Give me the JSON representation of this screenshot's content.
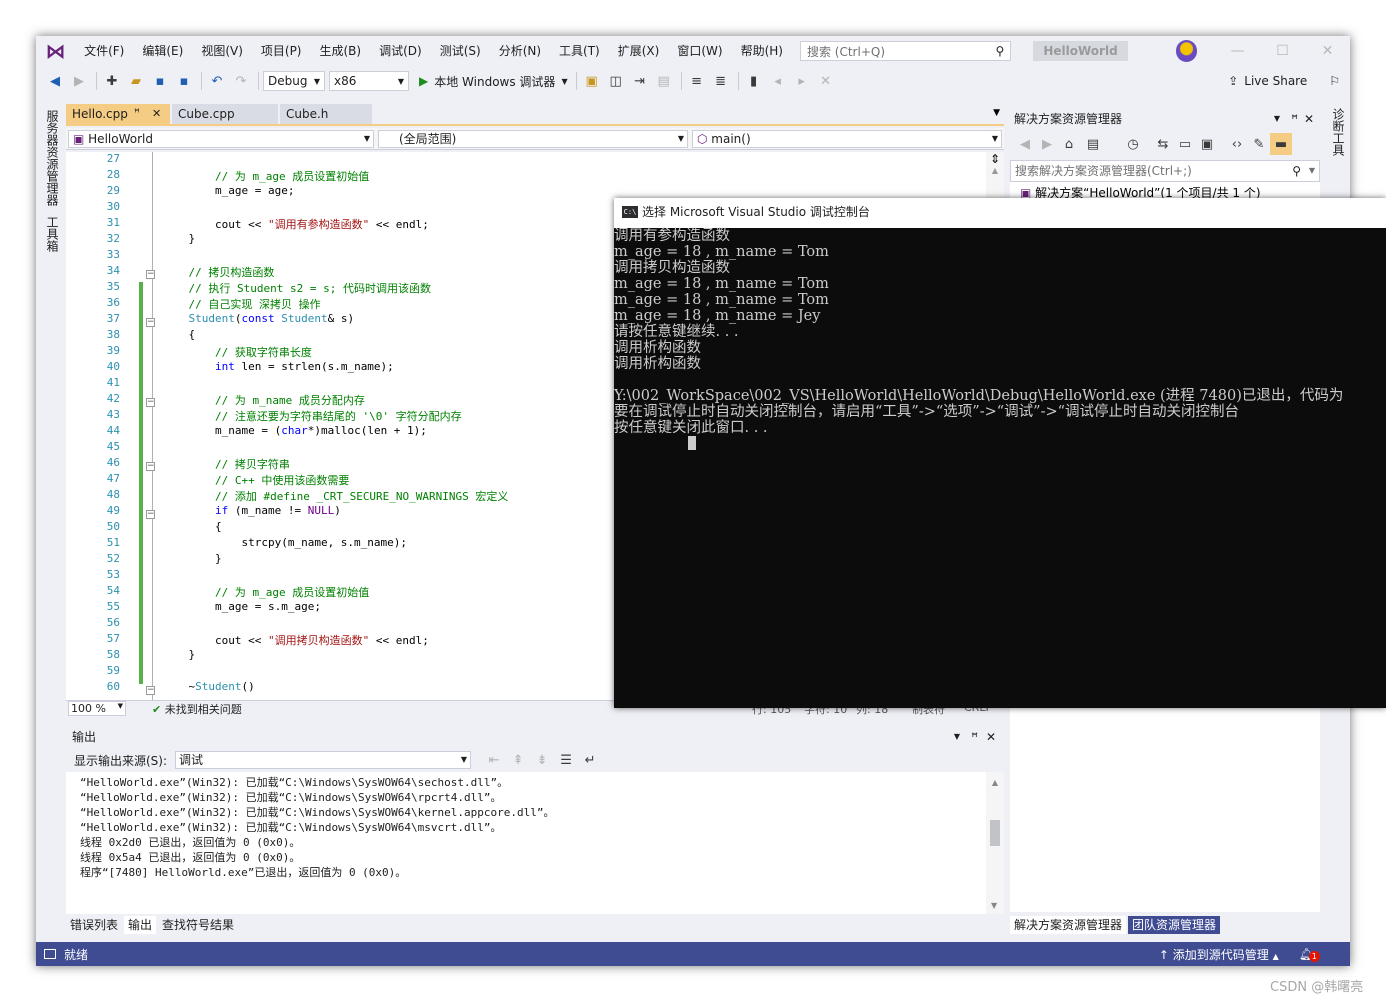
{
  "menu": {
    "items": [
      "文件(F)",
      "编辑(E)",
      "视图(V)",
      "项目(P)",
      "生成(B)",
      "调试(D)",
      "测试(S)",
      "分析(N)",
      "工具(T)",
      "扩展(X)",
      "窗口(W)",
      "帮助(H)"
    ],
    "search_placeholder": "搜索 (Ctrl+Q)",
    "solution_name": "HelloWorld"
  },
  "toolbar": {
    "config": "Debug",
    "platform": "x86",
    "run_label": "本地 Windows 调试器",
    "live_share": "Live Share"
  },
  "left_strip": {
    "server_explorer": "服务器资源管理器",
    "toolbox": "工具箱"
  },
  "right_strip": {
    "diagnostics": "诊断工具"
  },
  "editor": {
    "tabs": [
      {
        "label": "Hello.cpp",
        "pin": "ꟸ",
        "close": "✕",
        "active": true
      },
      {
        "label": "Cube.cpp",
        "active": false
      },
      {
        "label": "Cube.h",
        "active": false
      }
    ],
    "nav": {
      "project": "HelloWorld",
      "scope": "(全局范围)",
      "member": "main()"
    },
    "status": {
      "zoom": "100 %",
      "issues": "未找到相关问题",
      "line": "行: 105",
      "char": "字符: 10",
      "col": "列: 18",
      "indent": "制表符",
      "eol": "CRLF"
    },
    "lines": [
      {
        "n": "27",
        "code": ""
      },
      {
        "n": "28",
        "code": "        // 为 m_age 成员设置初始值"
      },
      {
        "n": "29",
        "code": "        m_age = age;"
      },
      {
        "n": "30",
        "code": ""
      },
      {
        "n": "31",
        "code": "        cout << \"调用有参构造函数\" << endl;"
      },
      {
        "n": "32",
        "code": "    }"
      },
      {
        "n": "33",
        "code": ""
      },
      {
        "n": "34",
        "code": "    // 拷贝构造函数"
      },
      {
        "n": "35",
        "code": "    // 执行 Student s2 = s; 代码时调用该函数"
      },
      {
        "n": "36",
        "code": "    // 自己实现 深拷贝 操作"
      },
      {
        "n": "37",
        "code": "    Student(const Student& s)"
      },
      {
        "n": "38",
        "code": "    {"
      },
      {
        "n": "39",
        "code": "        // 获取字符串长度"
      },
      {
        "n": "40",
        "code": "        int len = strlen(s.m_name);"
      },
      {
        "n": "41",
        "code": ""
      },
      {
        "n": "42",
        "code": "        // 为 m_name 成员分配内存"
      },
      {
        "n": "43",
        "code": "        // 注意还要为字符串结尾的 '\\0' 字符分配内存"
      },
      {
        "n": "44",
        "code": "        m_name = (char*)malloc(len + 1);"
      },
      {
        "n": "45",
        "code": ""
      },
      {
        "n": "46",
        "code": "        // 拷贝字符串"
      },
      {
        "n": "47",
        "code": "        // C++ 中使用该函数需要"
      },
      {
        "n": "48",
        "code": "        // 添加 #define _CRT_SECURE_NO_WARNINGS 宏定义"
      },
      {
        "n": "49",
        "code": "        if (m_name != NULL)"
      },
      {
        "n": "50",
        "code": "        {"
      },
      {
        "n": "51",
        "code": "            strcpy(m_name, s.m_name);"
      },
      {
        "n": "52",
        "code": "        }"
      },
      {
        "n": "53",
        "code": ""
      },
      {
        "n": "54",
        "code": "        // 为 m_age 成员设置初始值"
      },
      {
        "n": "55",
        "code": "        m_age = s.m_age;"
      },
      {
        "n": "56",
        "code": ""
      },
      {
        "n": "57",
        "code": "        cout << \"调用拷贝构造函数\" << endl;"
      },
      {
        "n": "58",
        "code": "    }"
      },
      {
        "n": "59",
        "code": ""
      },
      {
        "n": "60",
        "code": "    ~Student()"
      }
    ]
  },
  "output": {
    "title": "输出",
    "source_label": "显示输出来源(S):",
    "source_value": "调试",
    "lines": [
      "“HelloWorld.exe”(Win32): 已加载“C:\\Windows\\SysWOW64\\sechost.dll”。",
      "“HelloWorld.exe”(Win32): 已加载“C:\\Windows\\SysWOW64\\rpcrt4.dll”。",
      "“HelloWorld.exe”(Win32): 已加载“C:\\Windows\\SysWOW64\\kernel.appcore.dll”。",
      "“HelloWorld.exe”(Win32): 已加载“C:\\Windows\\SysWOW64\\msvcrt.dll”。",
      "线程 0x2d0 已退出，返回值为 0 (0x0)。",
      "线程 0x5a4 已退出，返回值为 0 (0x0)。",
      "程序“[7480] HelloWorld.exe”已退出，返回值为 0 (0x0)。"
    ],
    "tabs": [
      "错误列表",
      "输出",
      "查找符号结果"
    ]
  },
  "solution_explorer": {
    "title": "解决方案资源管理器",
    "search_placeholder": "搜索解决方案资源管理器(Ctrl+;)",
    "root": "解决方案“HelloWorld”(1 个项目/共 1 个)",
    "tabs": [
      "解决方案资源管理器",
      "团队资源管理器"
    ]
  },
  "statusbar": {
    "ready": "就绪",
    "source_control": "添加到源代码管理",
    "notifications": "1"
  },
  "console": {
    "title": "选择 Microsoft Visual Studio 调试控制台",
    "lines": [
      "调用有参构造函数",
      "m_age = 18 , m_name = Tom",
      "调用拷贝构造函数",
      "m_age = 18 , m_name = Tom",
      "m_age = 18 , m_name = Tom",
      "m_age = 18 , m_name = Jey",
      "请按任意键继续. . .",
      "调用析构函数",
      "调用析构函数",
      "",
      "Y:\\002_WorkSpace\\002_VS\\HelloWorld\\HelloWorld\\Debug\\HelloWorld.exe (进程 7480)已退出，代码为",
      "要在调试停止时自动关闭控制台，请启用“工具”->“选项”->“调试”->“调试停止时自动关闭控制台",
      "按任意键关闭此窗口. . ."
    ]
  },
  "watermark": "CSDN @韩曙亮"
}
